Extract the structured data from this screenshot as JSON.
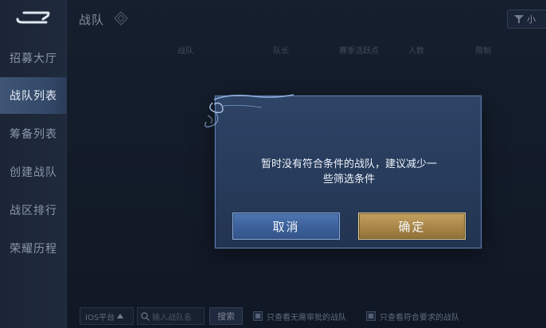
{
  "sidebar": {
    "items": [
      {
        "label": "招募大厅"
      },
      {
        "label": "战队列表"
      },
      {
        "label": "筹备列表"
      },
      {
        "label": "创建战队"
      },
      {
        "label": "战区排行"
      },
      {
        "label": "荣耀历程"
      }
    ],
    "active_index": 1
  },
  "header": {
    "title": "战队",
    "right_button_label": "小"
  },
  "table": {
    "columns": [
      "战队",
      "队长",
      "赛季活跃点",
      "人数",
      "限制"
    ]
  },
  "footer": {
    "platform_select": "IOS平台",
    "search_placeholder": "输入战队名",
    "search_button": "搜索",
    "filter_no_approval": "只查看无需审批的战队",
    "filter_meets_requirements": "只查看符合要求的战队"
  },
  "dialog": {
    "message_line1": "暂时没有符合条件的战队，建议减少一",
    "message_line2": "些筛选条件",
    "cancel_label": "取消",
    "confirm_label": "确定"
  },
  "colors": {
    "active_tab": "#3e5574",
    "cancel_button": "#3d619c",
    "confirm_button": "#a88648",
    "dialog_bg": "#2a3f60"
  }
}
